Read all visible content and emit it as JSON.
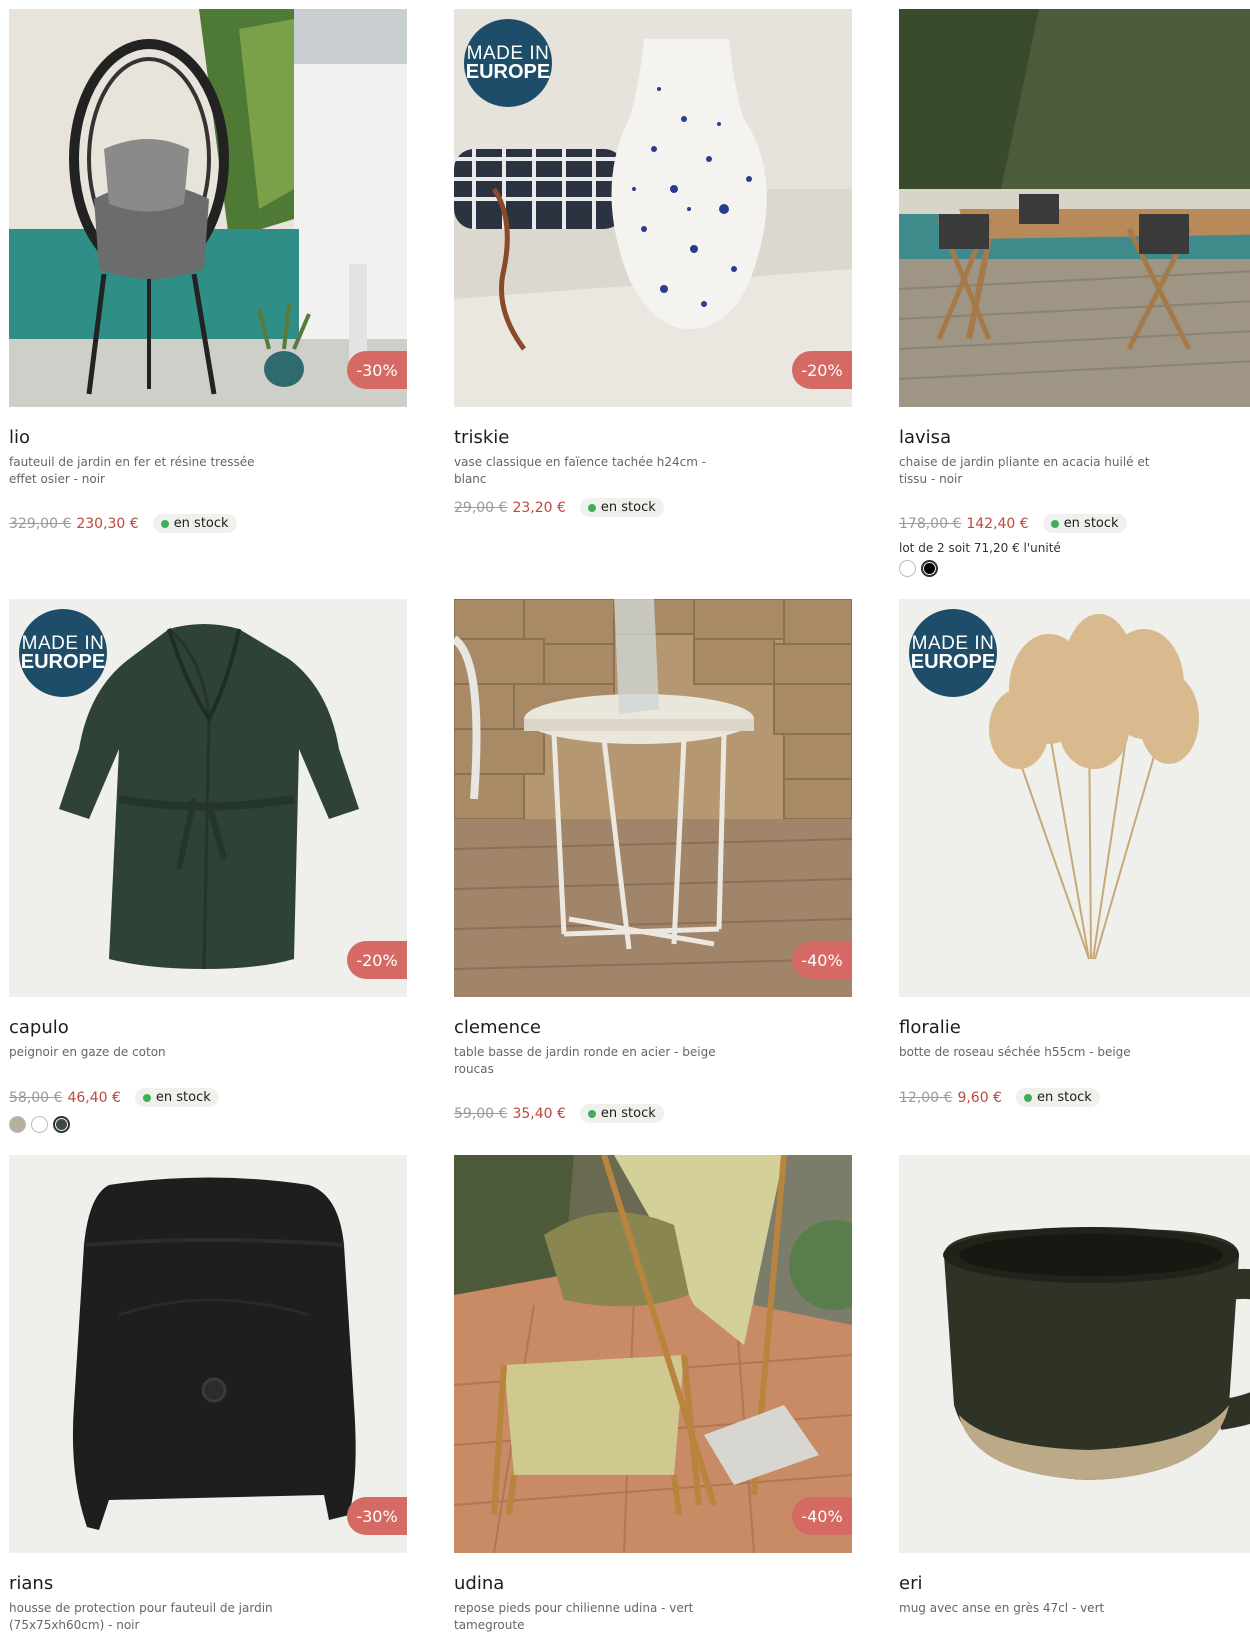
{
  "products": [
    {
      "name": "lio",
      "desc": "fauteuil de jardin en fer et résine tressée effet osier - noir",
      "old": "329,00 €",
      "new": "230,30 €",
      "stock": "en stock",
      "discount": "-30%"
    },
    {
      "name": "triskie",
      "desc": "vase classique en faïence tachée h24cm - blanc",
      "old": "29,00 €",
      "new": "23,20 €",
      "stock": "en stock",
      "discount": "-20%",
      "badge": [
        "MADE IN",
        "EUROPE"
      ]
    },
    {
      "name": "lavisa",
      "desc": "chaise de jardin pliante en acacia huilé et tissu - noir",
      "old": "178,00 €",
      "new": "142,40 €",
      "stock": "en stock",
      "lot": "lot de 2 soit 71,20 € l'unité"
    },
    {
      "name": "capulo",
      "desc": "peignoir en gaze de coton",
      "old": "58,00 €",
      "new": "46,40 €",
      "stock": "en stock",
      "discount": "-20%",
      "badge": [
        "MADE IN",
        "EUROPE"
      ]
    },
    {
      "name": "clemence",
      "desc": "table basse de jardin ronde en acier - beige roucas",
      "old": "59,00 €",
      "new": "35,40 €",
      "stock": "en stock",
      "discount": "-40%"
    },
    {
      "name": "floralie",
      "desc": "botte de roseau séchée h55cm - beige",
      "old": "12,00 €",
      "new": "9,60 €",
      "stock": "en stock",
      "badge": [
        "MADE IN",
        "EUROPE"
      ]
    },
    {
      "name": "rians",
      "desc": "housse de protection pour fauteuil de jardin (75x75xh60cm) - noir",
      "discount": "-30%"
    },
    {
      "name": "udina",
      "desc": "repose pieds pour chilienne udina - vert tamegroute",
      "discount": "-40%"
    },
    {
      "name": "eri",
      "desc": "mug avec anse en grès 47cl - vert"
    }
  ],
  "colors": {
    "discount": "#d56a65",
    "price": "#c0463e",
    "badge": "#1d4d68",
    "stock_dot": "#3fae5a"
  }
}
